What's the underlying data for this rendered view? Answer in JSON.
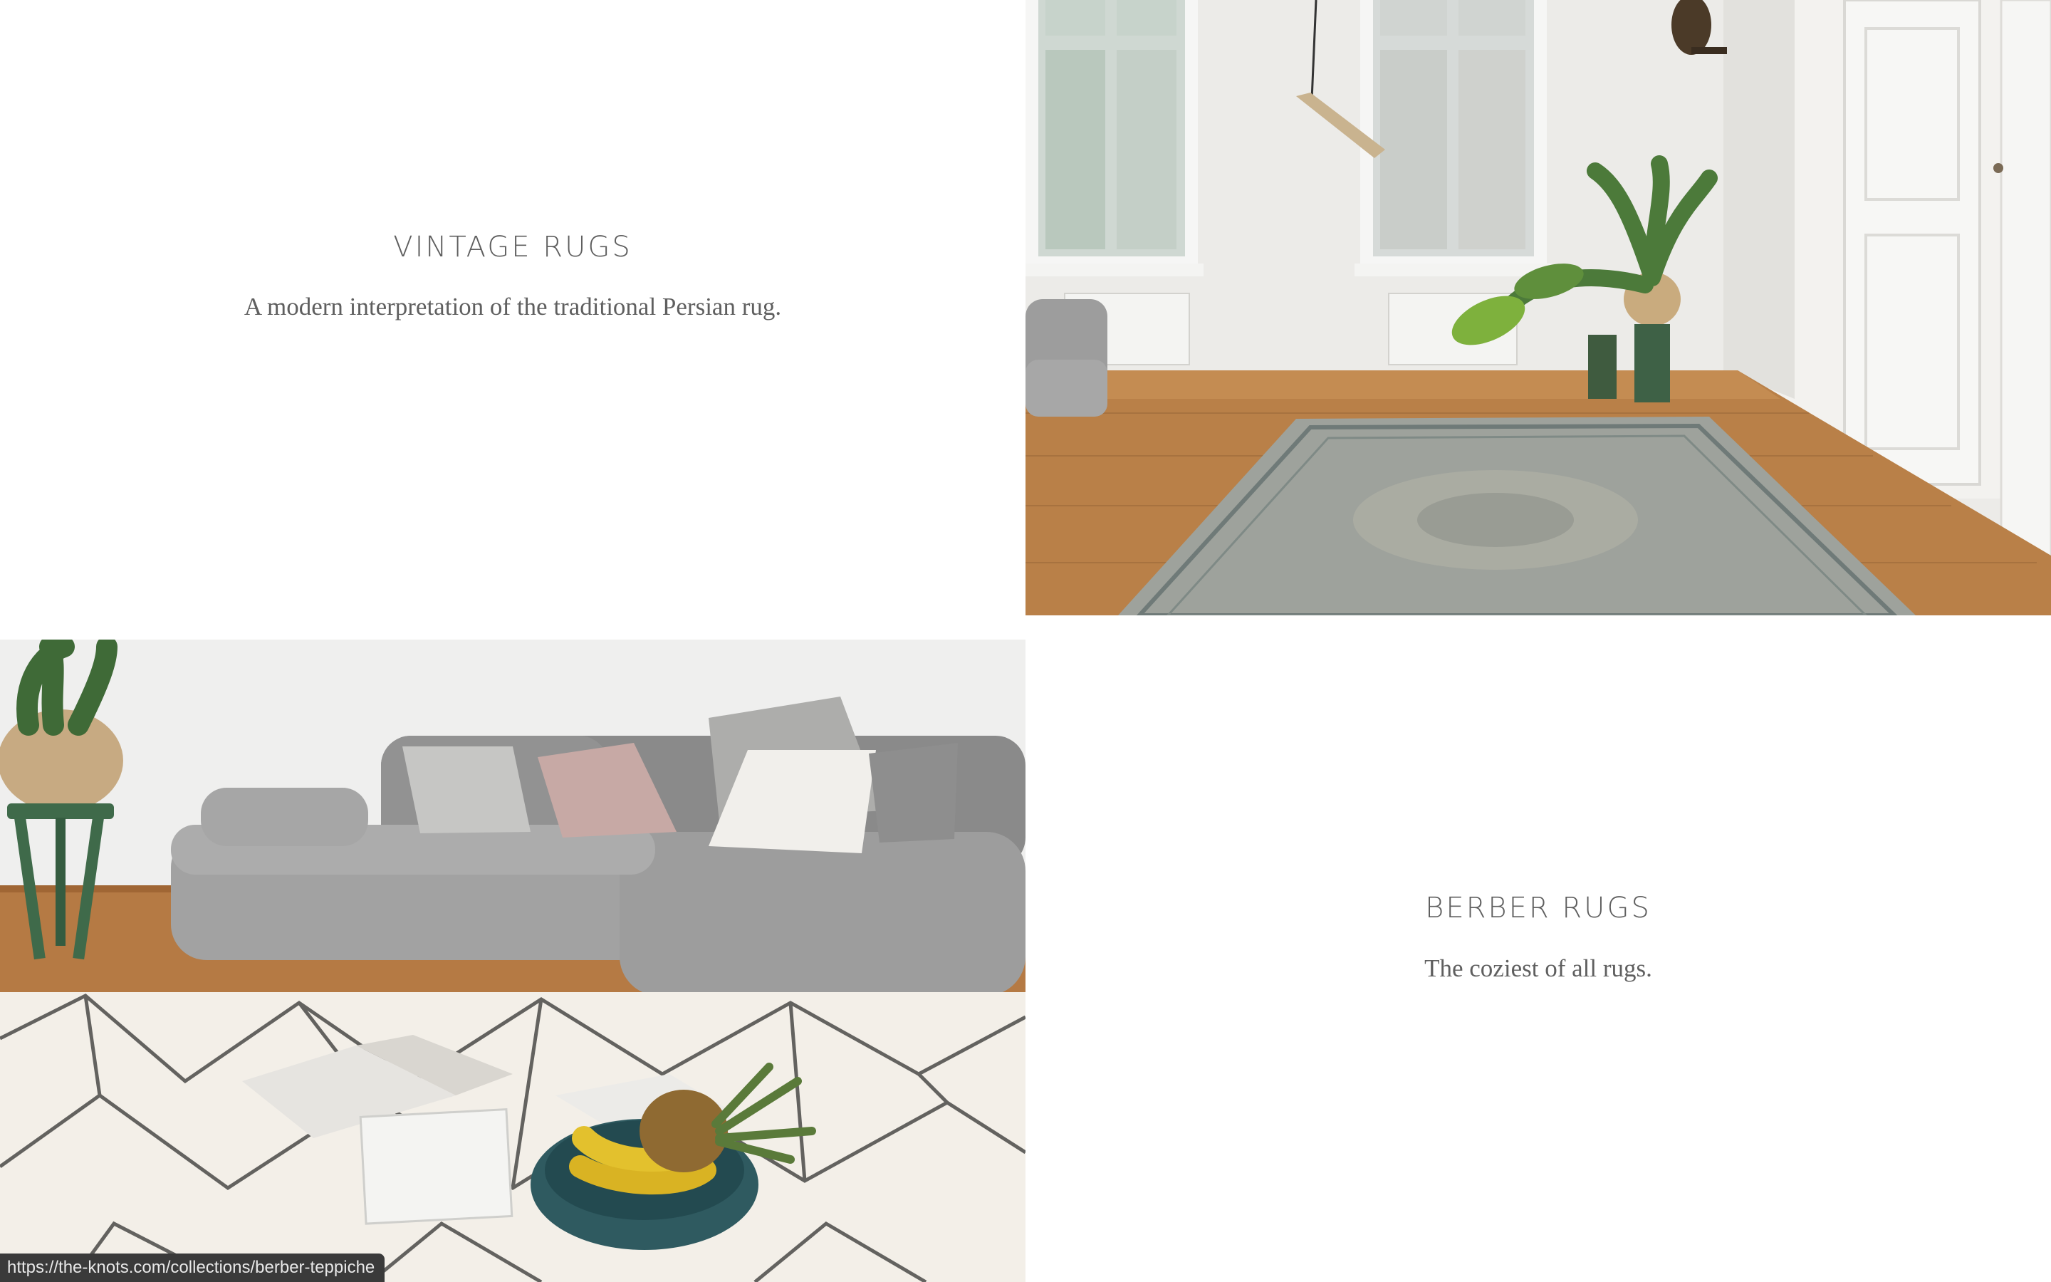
{
  "sections": [
    {
      "title": "VINTAGE RUGS",
      "subtitle": "A modern interpretation of the traditional Persian rug."
    },
    {
      "title": "BERBER RUGS",
      "subtitle": "The coziest of all rugs."
    }
  ],
  "status_bar": {
    "url": "https://the-knots.com/collections/berber-teppiche"
  },
  "colors": {
    "text": "#5f5f5f",
    "background": "#ffffff",
    "status_bar_bg": "#3a3a3a"
  }
}
